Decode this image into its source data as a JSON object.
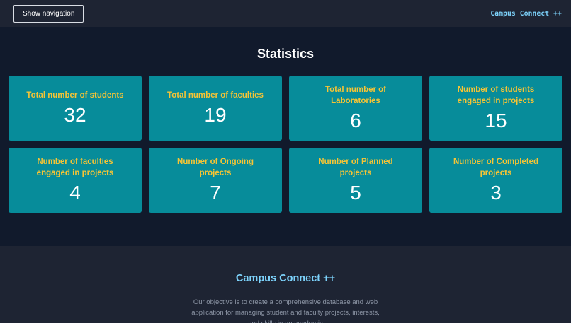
{
  "header": {
    "nav_button_label": "Show navigation",
    "brand": "Campus Connect ++"
  },
  "stats": {
    "title": "Statistics",
    "cards": [
      {
        "label": "Total number of students",
        "value": "32"
      },
      {
        "label": "Total number of faculties",
        "value": "19"
      },
      {
        "label": "Total number of Laboratories",
        "value": "6"
      },
      {
        "label": "Number of students engaged in projects",
        "value": "15"
      },
      {
        "label": "Number of faculties engaged in projects",
        "value": "4"
      },
      {
        "label": "Number of Ongoing projects",
        "value": "7"
      },
      {
        "label": "Number of Planned projects",
        "value": "5"
      },
      {
        "label": "Number of Completed projects",
        "value": "3"
      }
    ]
  },
  "footer": {
    "title": "Campus Connect ++",
    "description": "Our objective is to create a comprehensive database and web application for managing student and faculty projects, interests, and skills in an academic"
  },
  "colors": {
    "card_bg": "#078c9a",
    "card_label": "#f6c435",
    "brand_accent": "#7dd3fc",
    "page_bg": "#111a2c"
  }
}
